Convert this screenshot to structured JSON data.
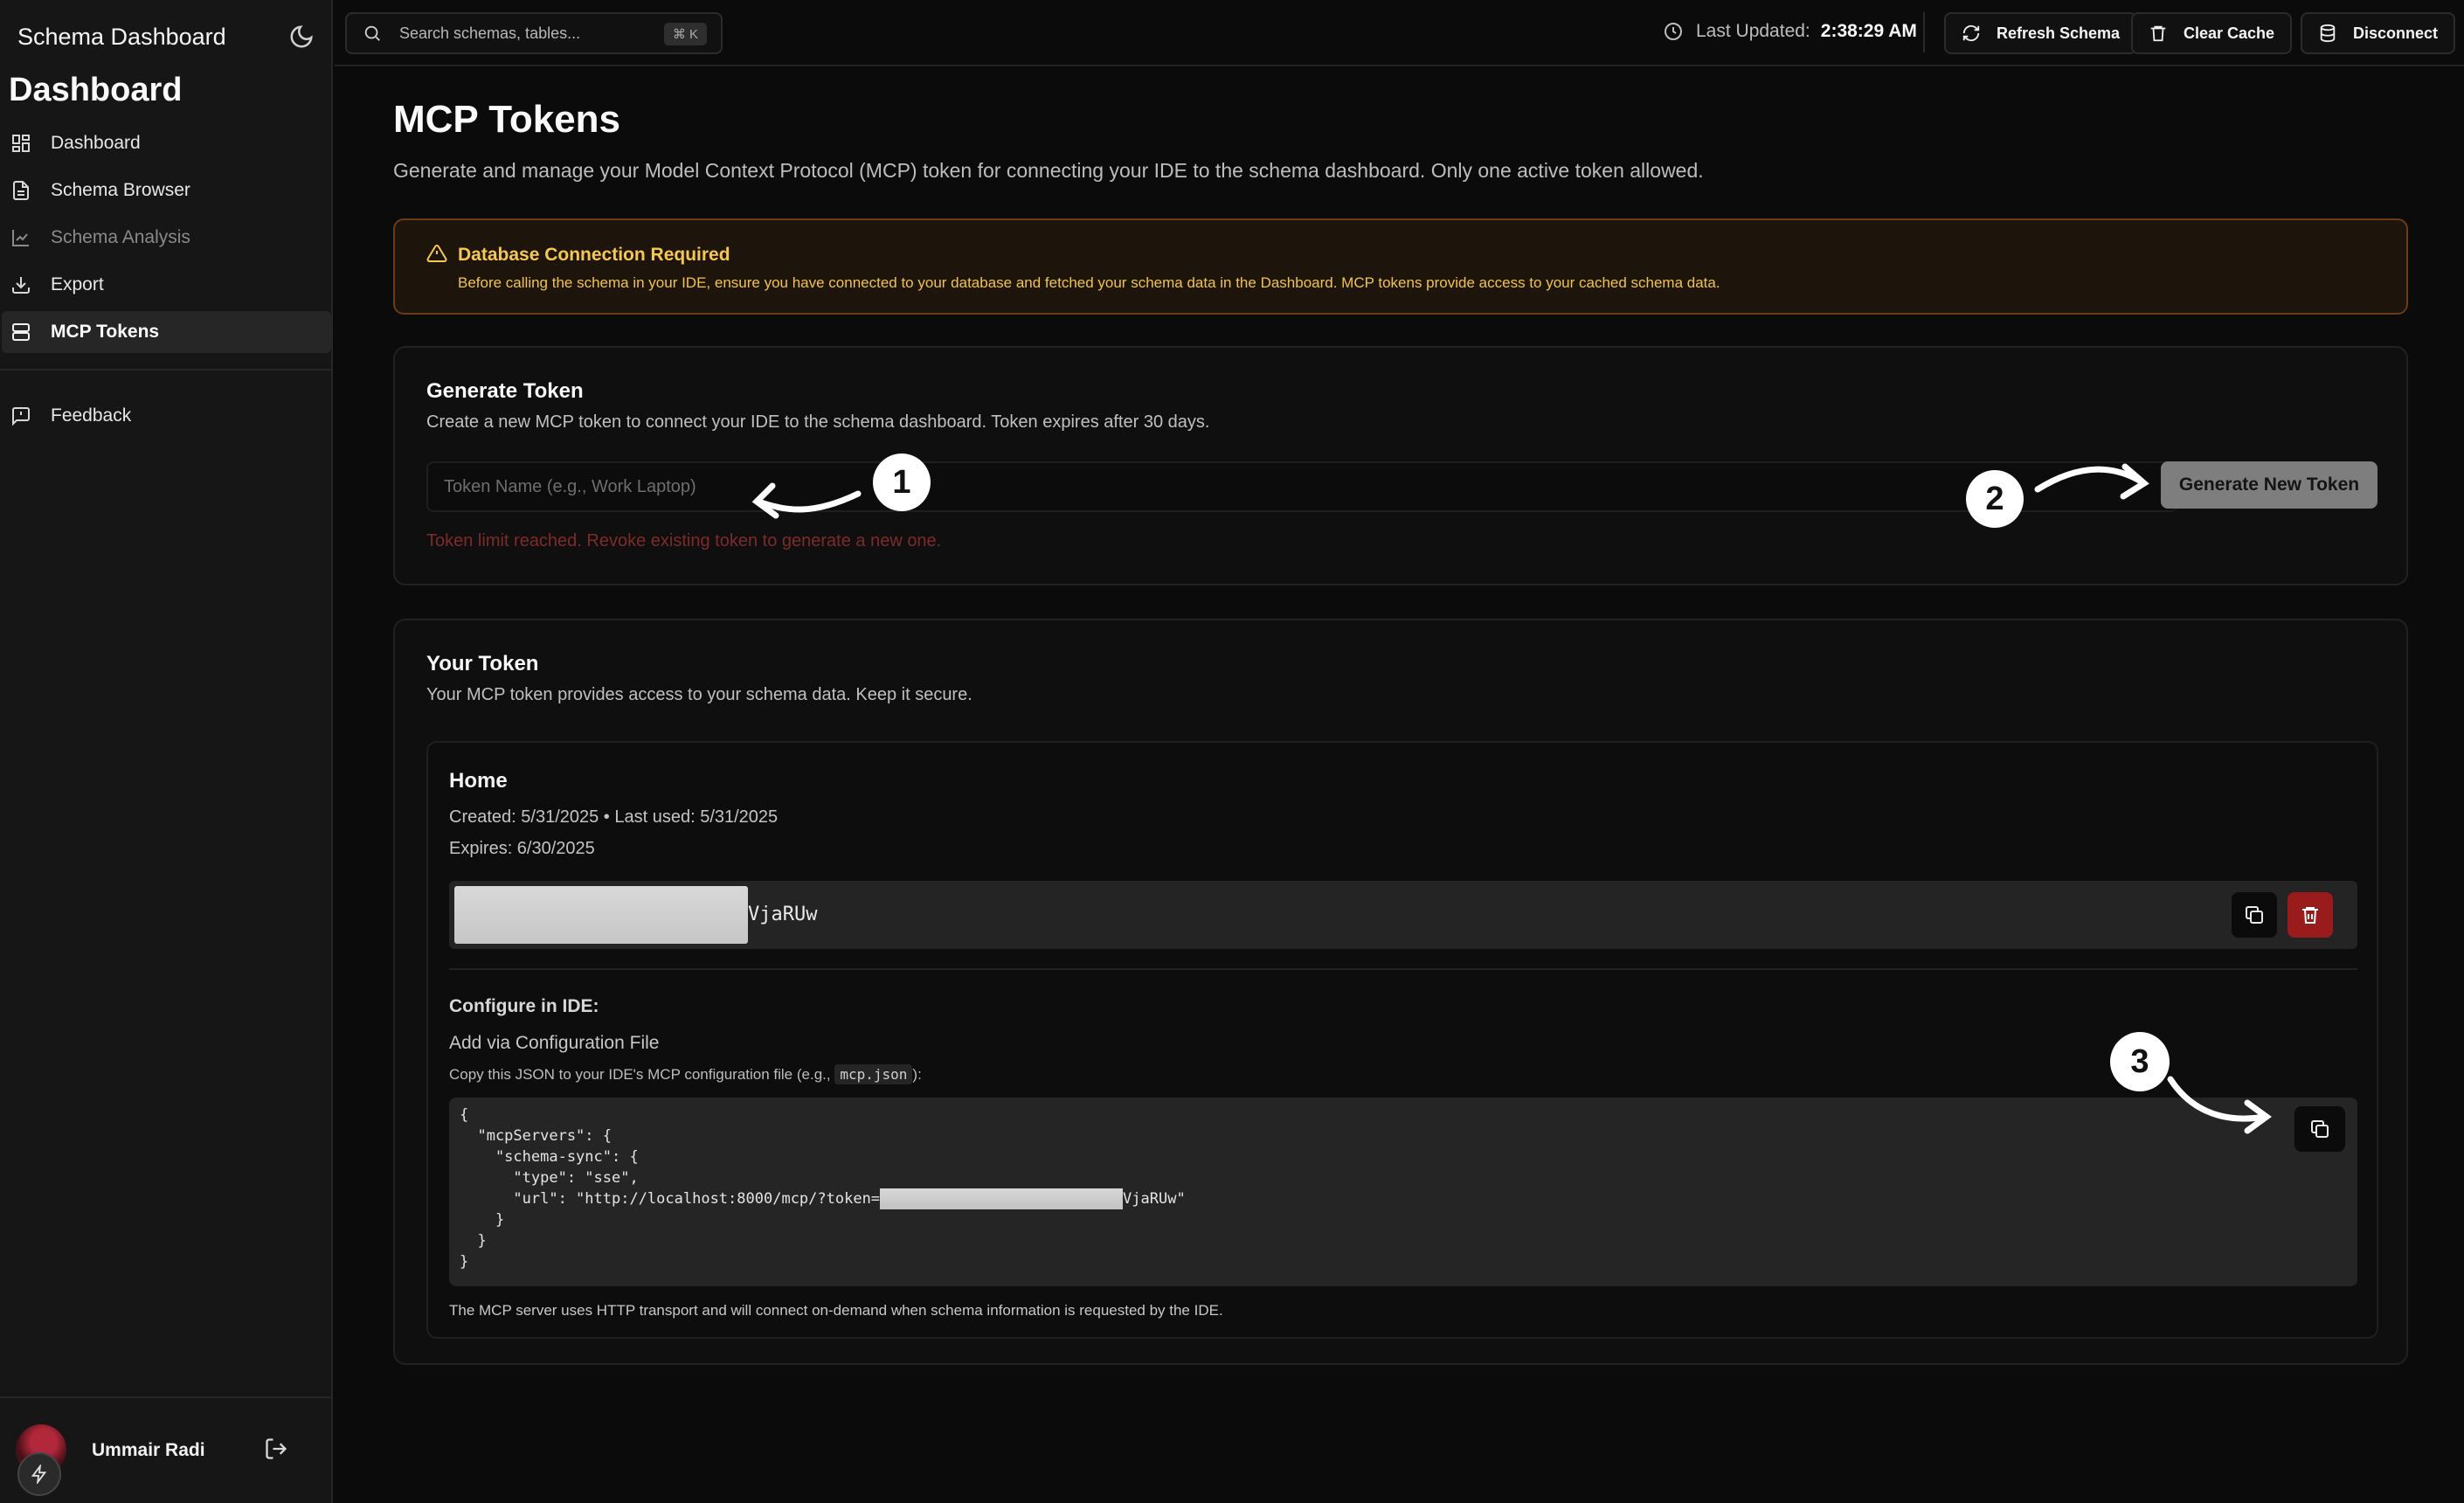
{
  "app": {
    "title": "Schema Dashboard",
    "section_title": "Dashboard"
  },
  "sidebar": {
    "items": [
      {
        "label": "Dashboard",
        "icon": "grid-icon"
      },
      {
        "label": "Schema Browser",
        "icon": "file-icon"
      },
      {
        "label": "Schema Analysis",
        "icon": "chart-icon"
      },
      {
        "label": "Export",
        "icon": "download-icon"
      },
      {
        "label": "MCP Tokens",
        "icon": "server-icon",
        "active": true
      }
    ],
    "feedback": "Feedback",
    "user": {
      "name": "Ummair Radi"
    }
  },
  "topbar": {
    "search_placeholder": "Search schemas, tables...",
    "shortcut": "⌘ K",
    "last_updated_label": "Last Updated:",
    "last_updated_value": "2:38:29 AM",
    "refresh": "Refresh Schema",
    "clear_cache": "Clear Cache",
    "disconnect": "Disconnect"
  },
  "page": {
    "title": "MCP Tokens",
    "description": "Generate and manage your Model Context Protocol (MCP) token for connecting your IDE to the schema dashboard. Only one active token allowed."
  },
  "alert": {
    "title": "Database Connection Required",
    "body": "Before calling the schema in your IDE, ensure you have connected to your database and fetched your schema data in the Dashboard. MCP tokens provide access to your cached schema data."
  },
  "generate": {
    "title": "Generate Token",
    "subtitle": "Create a new MCP token to connect your IDE to the schema dashboard. Token expires after 30 days.",
    "input_placeholder": "Token Name (e.g., Work Laptop)",
    "button": "Generate New Token",
    "error": "Token limit reached. Revoke existing token to generate a new one."
  },
  "your_token": {
    "title": "Your Token",
    "subtitle": "Your MCP token provides access to your schema data. Keep it secure.",
    "name": "Home",
    "created_line": "Created: 5/31/2025 • Last used: 5/31/2025",
    "expires_line": "Expires: 6/30/2025",
    "token_tail": "VjaRUw",
    "configure_title": "Configure in IDE:",
    "config_method": "Add via Configuration File",
    "config_hint_prefix": "Copy this JSON to your IDE's MCP configuration file (e.g.,",
    "config_hint_code": "mcp.json",
    "config_hint_suffix": "):",
    "json_line1": "{",
    "json_line2": "  \"mcpServers\": {",
    "json_line3": "    \"schema-sync\": {",
    "json_line4": "      \"type\": \"sse\",",
    "json_line5_prefix": "      \"url\": \"http://localhost:8000/mcp/?token=",
    "json_line5_suffix": "VjaRUw\"",
    "json_line6": "    }",
    "json_line7": "  }",
    "json_line8": "}",
    "footer": "The MCP server uses HTTP transport and will connect on-demand when schema information is requested by the IDE."
  },
  "annotations": {
    "m1": "1",
    "m2": "2",
    "m3": "3"
  },
  "colors": {
    "accent_warning": "#f7c948",
    "danger": "#991b1b",
    "error_text": "#7f2a2a"
  }
}
